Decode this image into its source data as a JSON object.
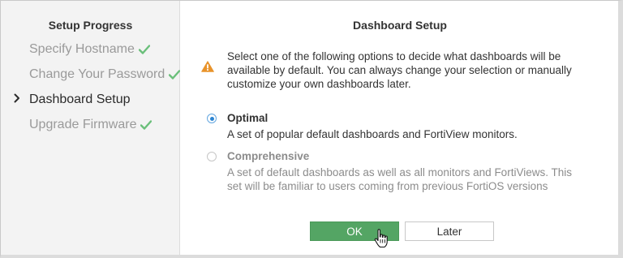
{
  "sidebar": {
    "title": "Setup Progress",
    "steps": [
      {
        "label": "Specify Hostname",
        "state": "done"
      },
      {
        "label": "Change Your Password",
        "state": "done"
      },
      {
        "label": "Dashboard Setup",
        "state": "current"
      },
      {
        "label": "Upgrade Firmware",
        "state": "done"
      }
    ],
    "current_marker_icon": "chevron-right-icon",
    "done_icon": "checkmark-icon"
  },
  "main": {
    "title": "Dashboard Setup",
    "warning_icon": "warning-triangle-icon",
    "intro": "Select one of the following options to decide what dashboards will be available by default. You can always change your selection or manually customize your own dashboards later.",
    "options": [
      {
        "title": "Optimal",
        "description": "A set of popular default dashboards and FortiView monitors.",
        "selected": true
      },
      {
        "title": "Comprehensive",
        "description": "A set of default dashboards as well as all monitors and FortiViews. This set will be familiar to users coming from previous FortiOS versions",
        "selected": false
      }
    ],
    "buttons": {
      "ok_label": "OK",
      "later_label": "Later"
    }
  },
  "colors": {
    "ok_button": "#54a564",
    "check": "#6abf7a",
    "warning": "#e8932b",
    "radio_selected": "#2b84d2",
    "sidebar_bg": "#f3f3f3"
  }
}
